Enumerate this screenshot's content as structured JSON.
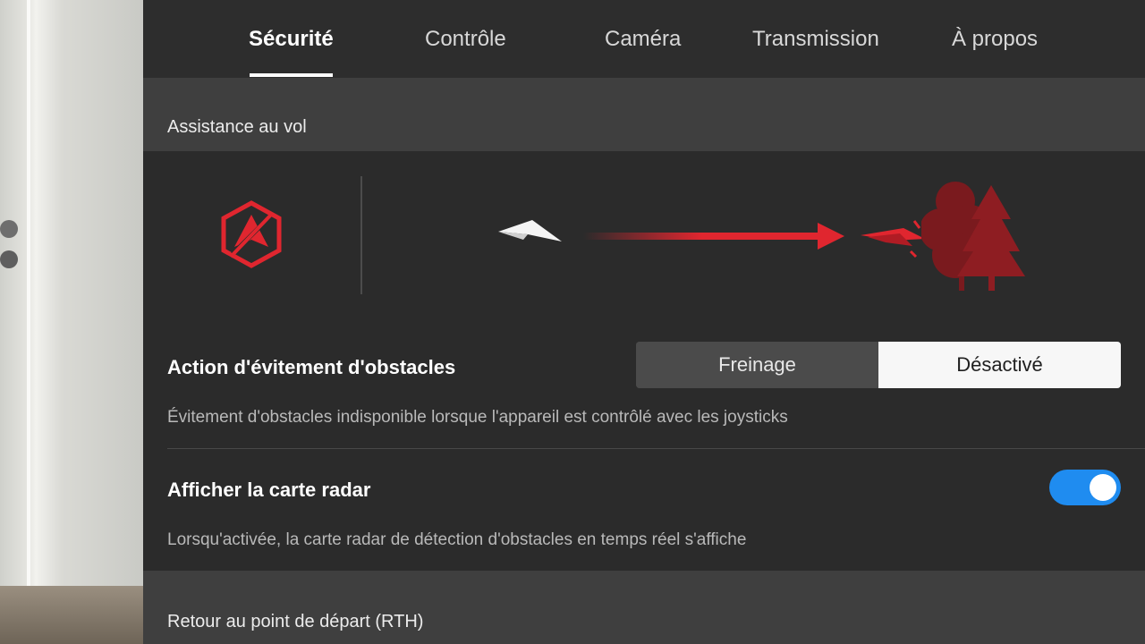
{
  "tabs": [
    {
      "label": "Sécurité",
      "active": true
    },
    {
      "label": "Contrôle",
      "active": false
    },
    {
      "label": "Caméra",
      "active": false
    },
    {
      "label": "Transmission",
      "active": false
    },
    {
      "label": "À propos",
      "active": false
    }
  ],
  "flight_assist": {
    "header": "Assistance au vol",
    "icons": [
      "obstacle-avoidance-icon",
      "paper-plane-icon",
      "arrow-right-icon",
      "collision-icon",
      "trees-icon"
    ]
  },
  "obstacle_action": {
    "title": "Action d'évitement d'obstacles",
    "options": [
      "Freinage",
      "Désactivé"
    ],
    "selected": "Désactivé",
    "description": "Évitement d'obstacles indisponible lorsque l'appareil est contrôlé avec les joysticks"
  },
  "radar_map": {
    "title": "Afficher la carte radar",
    "enabled": true,
    "description": "Lorsqu'activée, la carte radar de détection d'obstacles en temps réel s'affiche"
  },
  "rth": {
    "header": "Retour au point de départ (RTH)"
  },
  "colors": {
    "accent": "#1f8cf0",
    "warning_red": "#e0262f",
    "panel": "#2b2b2b",
    "section": "#3f3f3f"
  }
}
